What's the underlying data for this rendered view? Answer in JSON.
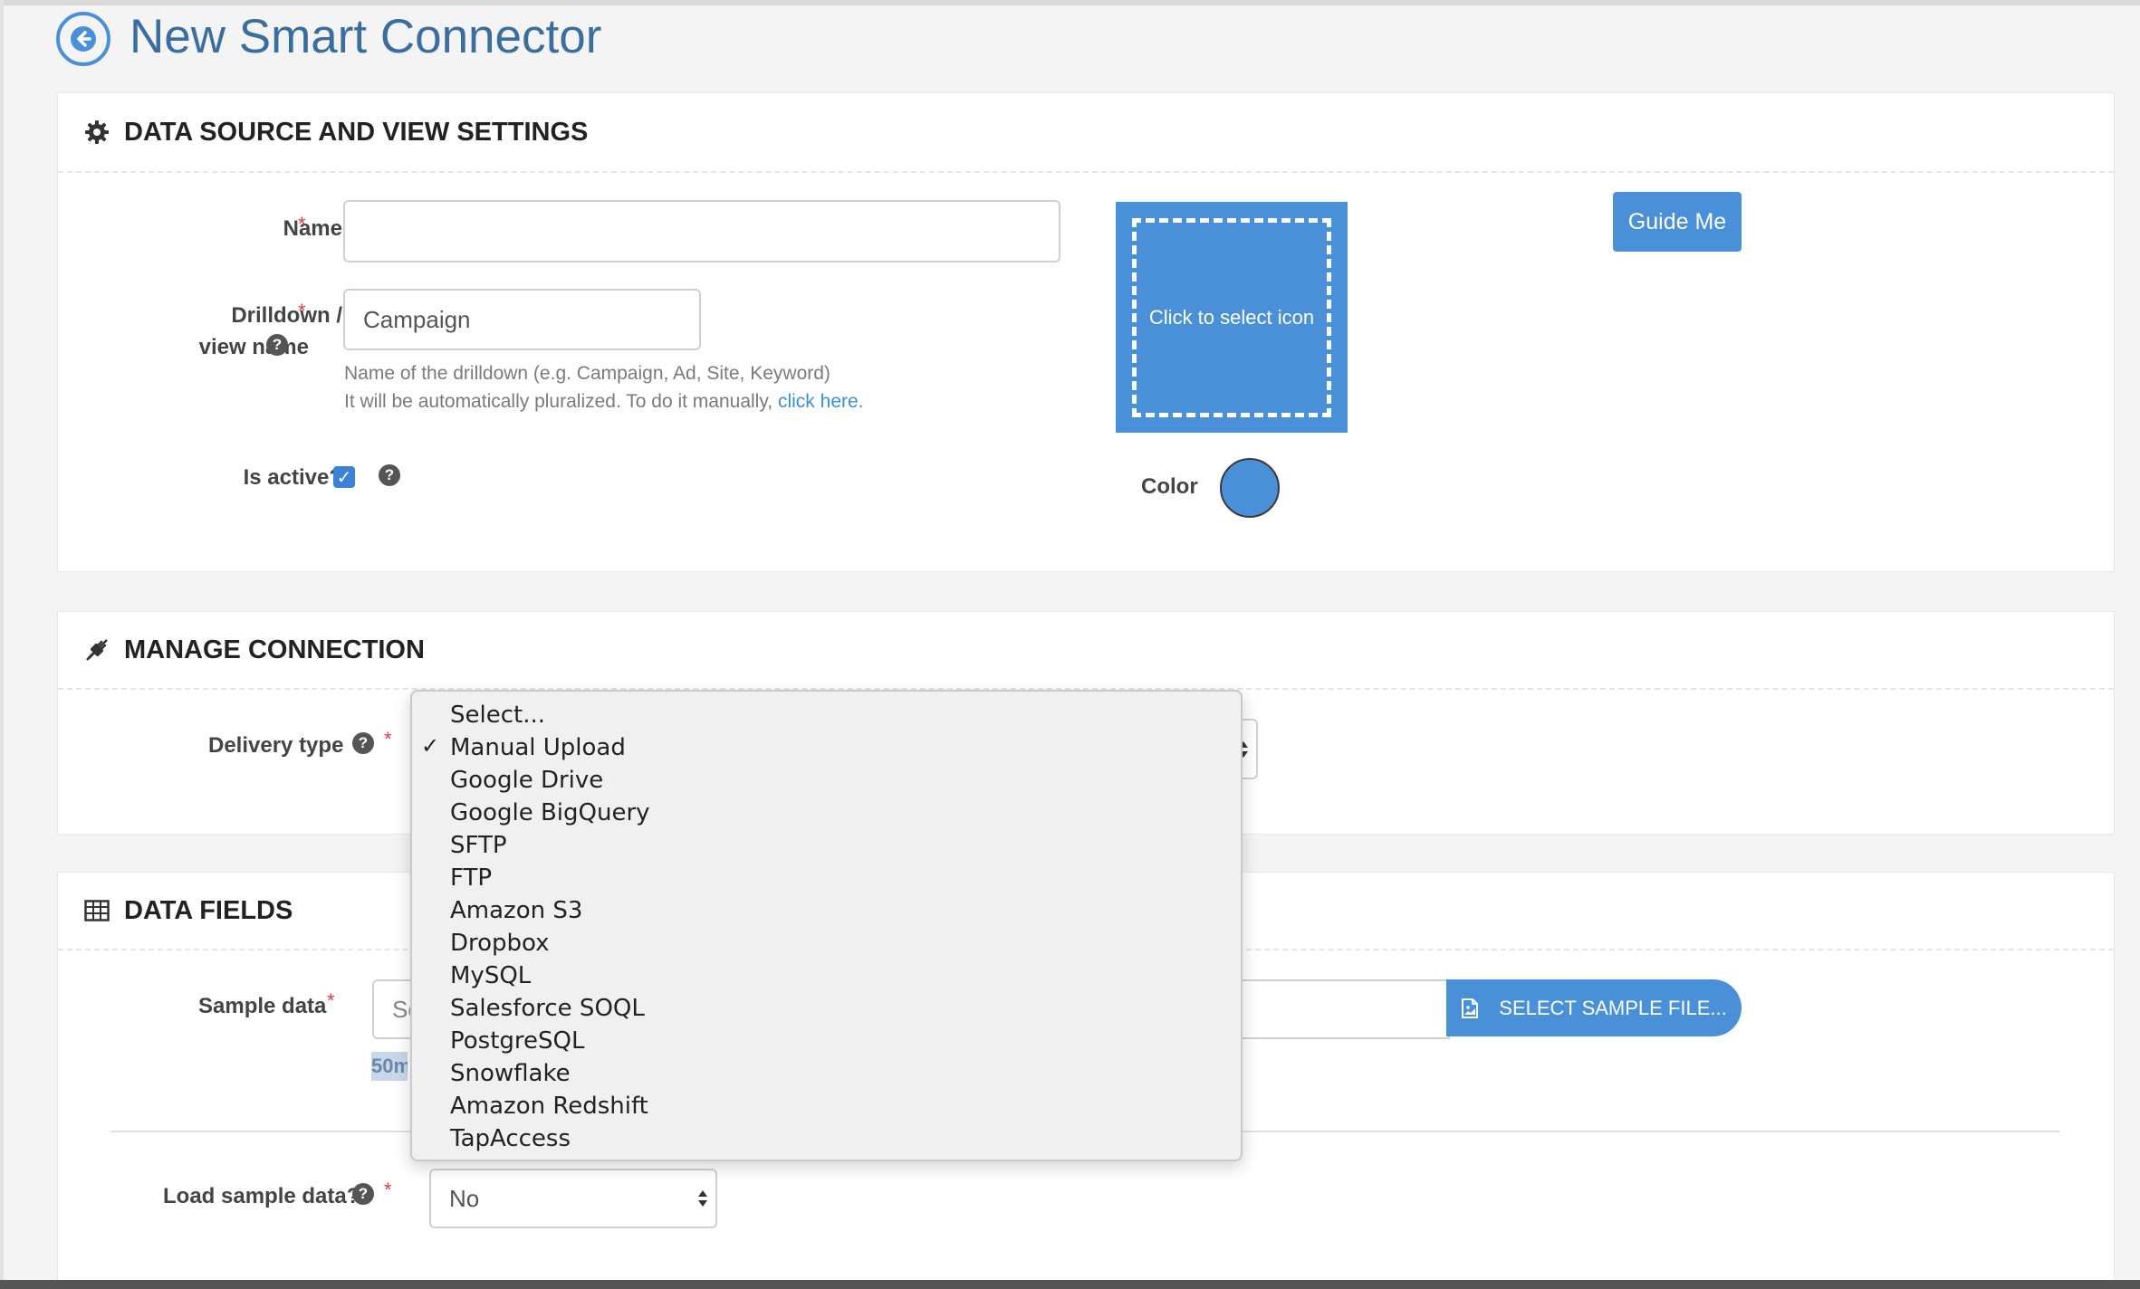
{
  "header": {
    "title": "New Smart Connector"
  },
  "data_source": {
    "section_title": "DATA SOURCE AND VIEW SETTINGS",
    "name": {
      "label": "Name",
      "required": "*",
      "value": ""
    },
    "drilldown": {
      "label_line1": "Drilldown /",
      "label_line2": "view name",
      "required": "*",
      "help_mark": "?",
      "value": "Campaign",
      "help_line1": "Name of the drilldown (e.g. Campaign, Ad, Site, Keyword)",
      "help_line2": "It will be automatically pluralized. To do it manually,",
      "help_link": "click here",
      "help_end": "."
    },
    "is_active": {
      "label": "Is active?",
      "checked": true,
      "check_mark": "✓",
      "help_mark": "?"
    },
    "icon_picker": {
      "text": "Click to select icon"
    },
    "color": {
      "label": "Color",
      "value": "#4a90d9"
    },
    "guide_button": "Guide Me"
  },
  "manage_connection": {
    "section_title": "MANAGE CONNECTION",
    "delivery_type": {
      "label": "Delivery type",
      "help_mark": "?",
      "required": "*",
      "selected": "Manual Upload",
      "options": [
        "Select...",
        "Manual Upload",
        "Google Drive",
        "Google BigQuery",
        "SFTP",
        "FTP",
        "Amazon S3",
        "Dropbox",
        "MySQL",
        "Salesforce SOQL",
        "PostgreSQL",
        "Snowflake",
        "Amazon Redshift",
        "TapAccess"
      ],
      "check_mark": "✓"
    }
  },
  "data_fields": {
    "section_title": "DATA FIELDS",
    "sample_data": {
      "label": "Sample data",
      "required": "*",
      "placeholder_visible": "Se",
      "size_hint_visible": "50m",
      "button": "SELECT SAMPLE FILE..."
    },
    "load_sample": {
      "label": "Load sample data?",
      "help_mark": "?",
      "required": "*",
      "value": "No"
    }
  },
  "colors": {
    "accent": "#4a90d9",
    "title": "#3a6e9f",
    "required": "#e23b3b"
  }
}
